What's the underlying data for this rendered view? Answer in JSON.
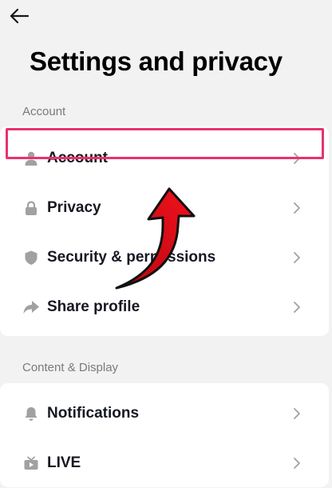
{
  "header": {
    "back_icon": "arrow-left-icon",
    "title": "Settings and privacy"
  },
  "sections": [
    {
      "label": "Account",
      "items": [
        {
          "label": "Account",
          "icon": "person-icon",
          "highlighted": true
        },
        {
          "label": "Privacy",
          "icon": "lock-icon"
        },
        {
          "label": "Security & permissions",
          "icon": "shield-icon"
        },
        {
          "label": "Share profile",
          "icon": "share-icon"
        }
      ]
    },
    {
      "label": "Content & Display",
      "items": [
        {
          "label": "Notifications",
          "icon": "bell-icon"
        },
        {
          "label": "LIVE",
          "icon": "tv-icon"
        }
      ]
    }
  ],
  "annotation": {
    "highlight_color": "#e8336d",
    "arrow_color": "#e3121b",
    "arrow_icon": "curved-arrow-icon"
  },
  "colors": {
    "background": "#f2f2f2",
    "card": "#ffffff",
    "icon": "#a1a1a1",
    "chevron": "#a1a1a1",
    "text": "#161823",
    "section_label": "#7a7a7a"
  }
}
